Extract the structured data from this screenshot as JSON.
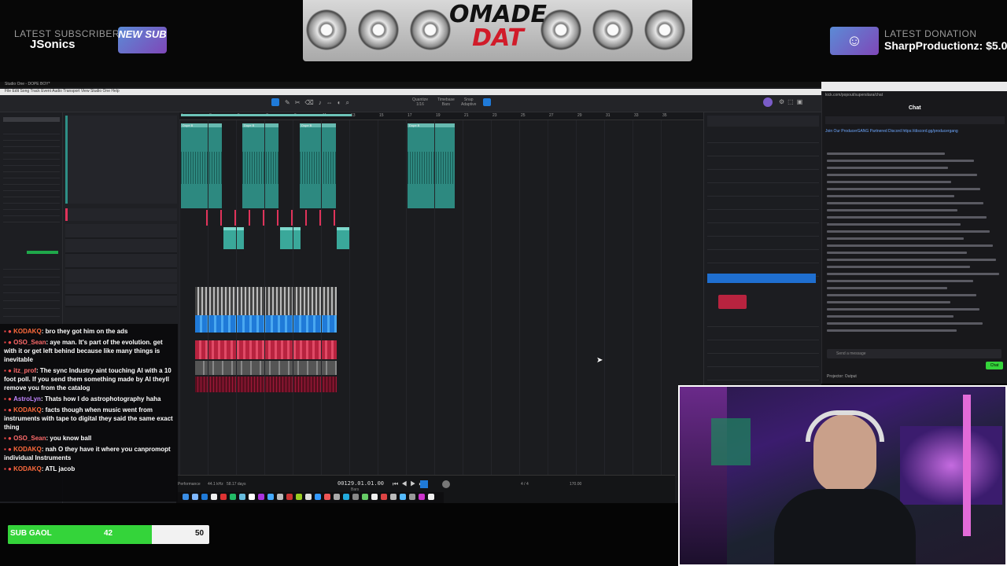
{
  "overlay": {
    "subscriber_label": "LATEST SUBSCRIBER",
    "subscriber_name": "JSonics",
    "badge_text": "NEW SUB",
    "logo_line1": "OMADE",
    "logo_line2": "DAT",
    "donation_label": "LATEST DONATION",
    "donation_text": "SharpProductionz: $5.0"
  },
  "daw": {
    "window_title": "Studio One - DOPE BOY*",
    "menu": [
      "File",
      "Edit",
      "Song",
      "Track",
      "Event",
      "Audio",
      "Transport",
      "View",
      "Studio One",
      "Help"
    ],
    "quantize_label": "Quantize",
    "quantize_value": "1/16",
    "timebase_label": "Timebase",
    "timebase_value": "Bars",
    "snap_label": "Snap",
    "snap_value": "Adaptive",
    "ruler": [
      "1",
      "3",
      "5",
      "7",
      "9",
      "11",
      "13",
      "15",
      "17",
      "19",
      "21",
      "23",
      "25",
      "27",
      "29",
      "31",
      "33",
      "35"
    ],
    "clip_label": "Dope B",
    "transport_time": "00129.01.01.00",
    "transport_bars": "Bars",
    "tempo": "170.00",
    "signature": "4 / 4",
    "performance_label": "Performance",
    "sample_rate": "44.1 kHz",
    "record_time": "58.17 days"
  },
  "stream_chat": [
    {
      "user": "KODAKQ",
      "text": ": bro they got him on the ads"
    },
    {
      "user": "OSO_Sean",
      "text": ": aye man. It's part of the evolution. get with it or get left behind because like many things is inevitable"
    },
    {
      "user": "itz_prof",
      "text": ": The sync Industry aint touching AI with a 10 foot poll. If you send them something made by AI theyll remove you from the catalog"
    },
    {
      "user": "AstroLyn",
      "text": ": Thats how I do astrophotography haha"
    },
    {
      "user": "KODAKQ",
      "text": ": facts though when music went from instruments with tape to digital they said the same exact thing"
    },
    {
      "user": "OSO_Sean",
      "text": ": you know ball"
    },
    {
      "user": "KODAKQ",
      "text": ": nah O they have it where you canpromopt individual Instruments"
    },
    {
      "user": "KODAKQ",
      "text": ": ATL jacob"
    }
  ],
  "browser_chat": {
    "url": "kick.com/popout/supersitara/chat",
    "title": "Chat",
    "pinned": "Join Our ProducerGANG Partnered Discord https://discord.gg/producergang",
    "input_placeholder": "Send a message",
    "chat_button": "Chat",
    "projector": "Projector: Output"
  },
  "sub_goal": {
    "label": "SUB GAOL",
    "current": "42",
    "target": "50",
    "progress": 0.84
  },
  "colors": {
    "clip": "#2e8f86",
    "goal_fill": "#34d43a",
    "accent_blue": "#1f7ad8",
    "midi": "#e0335a"
  }
}
